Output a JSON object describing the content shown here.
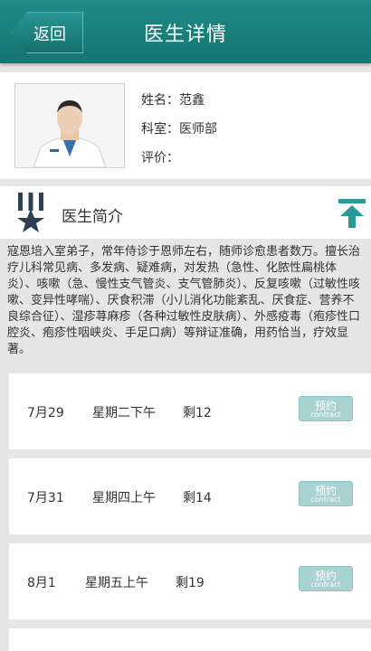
{
  "header": {
    "back_label": "返回",
    "title": "医生详情",
    "color": "#1a807c"
  },
  "profile": {
    "name_line": "姓名：范鑫",
    "dept_line": "科室：医师部",
    "rating_line": "评价："
  },
  "intro": {
    "title": "医生简介",
    "text": "寇恩培入室弟子，常年侍诊于恩师左右，随师诊愈患者数万。擅长治疗儿科常见病、多发病、疑难病，对发热（急性、化脓性扁桃体炎）、咳嗽（急、慢性支气管炎、支气管肺炎）、反复咳嗽（过敏性咳嗽、变异性哮喘）、厌食积滞（小儿消化功能紊乱、厌食症、营养不良综合征）、湿疹荨麻疹（各种过敏性皮肤病）、外感疫毒（疱疹性口腔炎、疱疹性咽峡炎、手足口病）等辩证准确，用药恰当，疗效显著。"
  },
  "slots": [
    {
      "date": "7月29",
      "session": "星期二下午",
      "remaining": "剩12",
      "button_zh": "预约",
      "button_en": "contract"
    },
    {
      "date": "7月31",
      "session": "星期四上午",
      "remaining": "剩14",
      "button_zh": "预约",
      "button_en": "contract"
    },
    {
      "date": "8月1",
      "session": "星期五上午",
      "remaining": "剩19",
      "button_zh": "预约",
      "button_en": "contract"
    }
  ]
}
